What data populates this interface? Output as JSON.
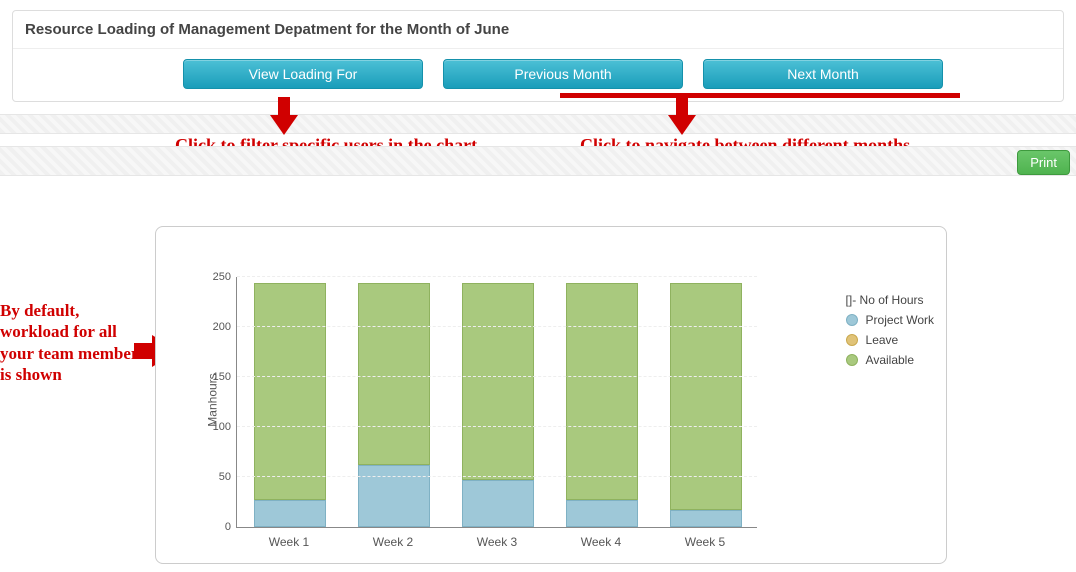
{
  "header": {
    "title": "Resource Loading of Management Depatment for the Month of June",
    "buttons": {
      "view_loading": "View Loading For",
      "prev_month": "Previous Month",
      "next_month": "Next Month"
    }
  },
  "toolbar": {
    "print_label": "Print"
  },
  "annotations": {
    "filter": "Click to filter specific users in the chart",
    "navigate": "Click to navigate between different months",
    "default_note": "By default, workload for all your team members is shown"
  },
  "chart_data": {
    "type": "bar",
    "stacked": true,
    "ylabel": "Manhours",
    "ylim": [
      0,
      250
    ],
    "yticks": [
      0,
      50,
      100,
      150,
      200,
      250
    ],
    "categories": [
      "Week 1",
      "Week 2",
      "Week 3",
      "Week 4",
      "Week 5"
    ],
    "series": [
      {
        "name": "Project Work",
        "key": "proj",
        "color": "#9ec8d8",
        "values": [
          25,
          60,
          45,
          25,
          15
        ]
      },
      {
        "name": "Leave",
        "key": "leave",
        "color": "#e0c378",
        "values": [
          0,
          0,
          0,
          0,
          0
        ]
      },
      {
        "name": "Available",
        "key": "avail",
        "color": "#a9c97e",
        "values": [
          215,
          180,
          195,
          215,
          225
        ]
      }
    ],
    "legend_title": "[]- No of Hours",
    "legend": [
      "Project Work",
      "Leave",
      "Available"
    ]
  }
}
